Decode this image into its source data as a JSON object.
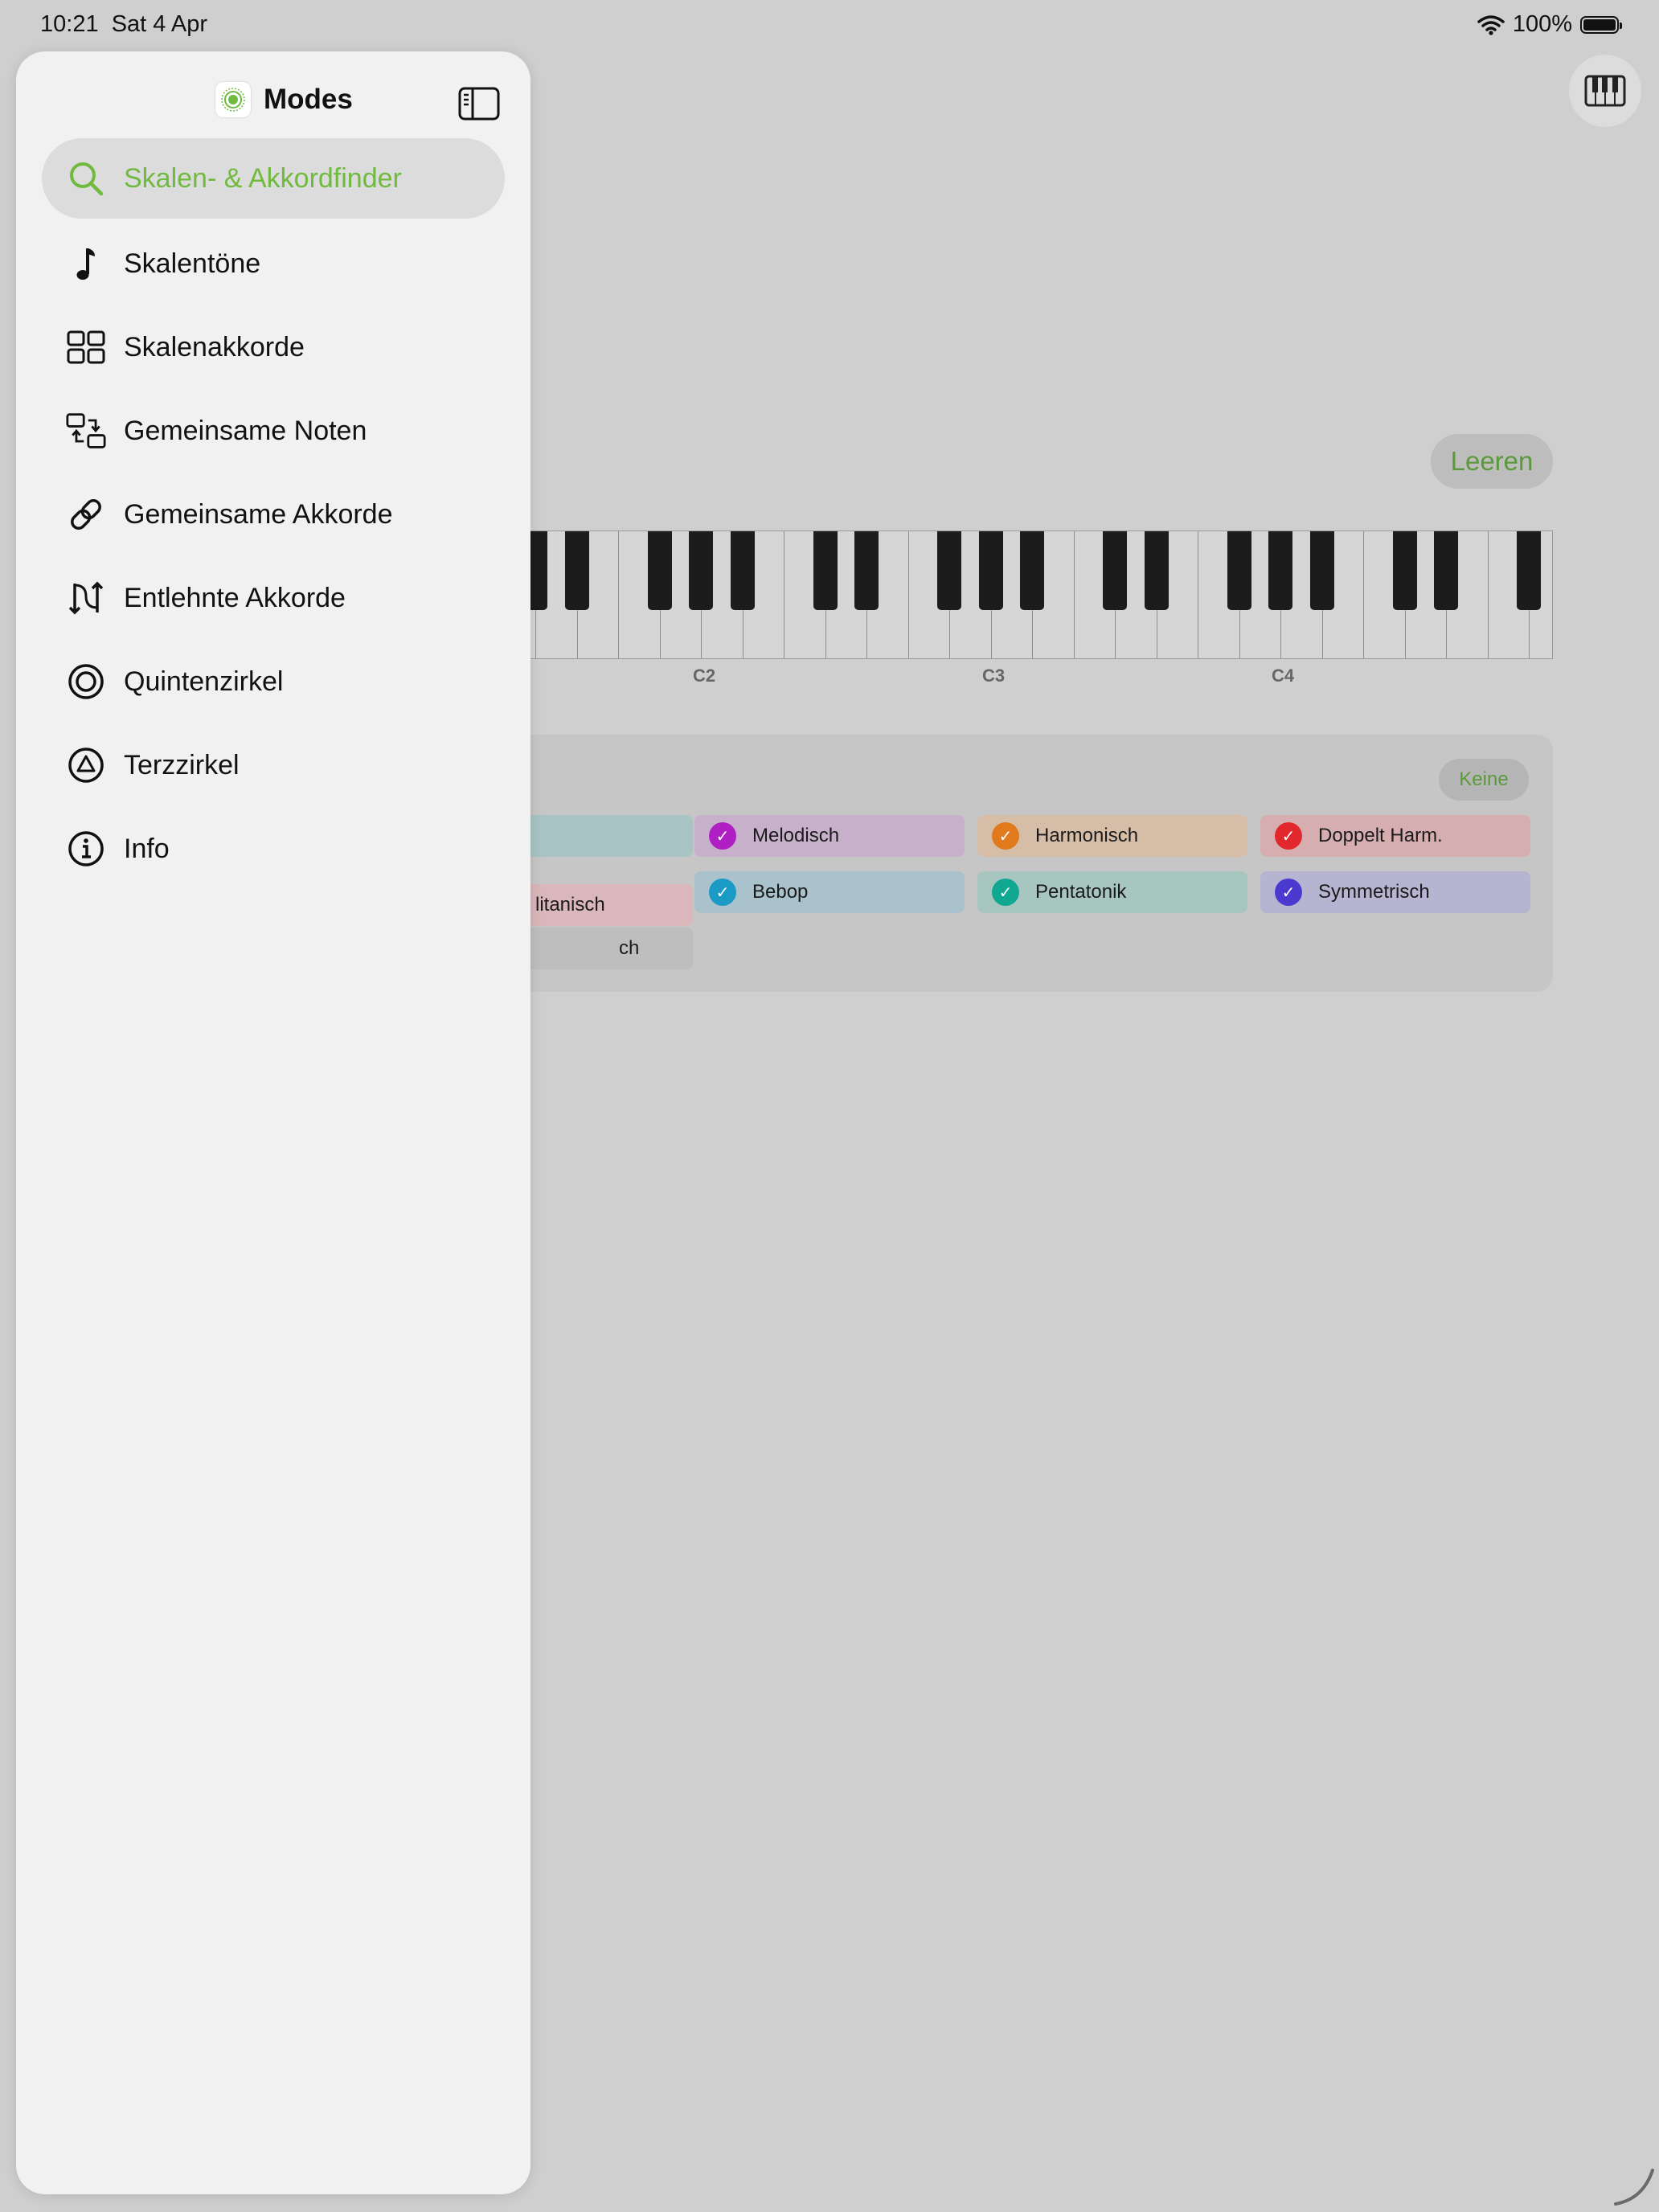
{
  "status_bar": {
    "time": "10:21",
    "date": "Sat 4 Apr",
    "battery": "100%"
  },
  "background": {
    "clear_label": "Leeren",
    "none_label": "Keine",
    "octave_labels": [
      "C2",
      "C3",
      "C4"
    ],
    "chips": [
      {
        "label": "litanisch",
        "color": "#e0939a"
      },
      {
        "label": "Melodisch",
        "color": "#b01fc4"
      },
      {
        "label": "Harmonisch",
        "color": "#e07a1c"
      },
      {
        "label": "Doppelt Harm.",
        "color": "#e0282e"
      },
      {
        "label": "Bebop",
        "color": "#1a9ac4"
      },
      {
        "label": "Pentatonik",
        "color": "#10a890"
      },
      {
        "label": "Symmetrisch",
        "color": "#4a3ad0"
      },
      {
        "label": "ch",
        "color": "#9a9a9a"
      }
    ]
  },
  "sidebar": {
    "title": "Modes",
    "items": [
      {
        "label": "Skalen- & Akkordfinder",
        "icon": "search-icon",
        "active": true
      },
      {
        "label": "Skalentöne",
        "icon": "music-note-icon"
      },
      {
        "label": "Skalenakkorde",
        "icon": "grid-icon"
      },
      {
        "label": "Gemeinsame Noten",
        "icon": "swap-icon"
      },
      {
        "label": "Gemeinsame Akkorde",
        "icon": "link-icon"
      },
      {
        "label": "Entlehnte Akkorde",
        "icon": "arrows-updown-icon"
      },
      {
        "label": "Quintenzirkel",
        "icon": "circle-icon"
      },
      {
        "label": "Terzzirkel",
        "icon": "triangle-circle-icon"
      },
      {
        "label": "Info",
        "icon": "info-icon"
      }
    ]
  },
  "colors": {
    "accent": "#6fba3f",
    "sidebar_bg": "#f1f1f1",
    "dim_bg": "#cfcfcf"
  }
}
